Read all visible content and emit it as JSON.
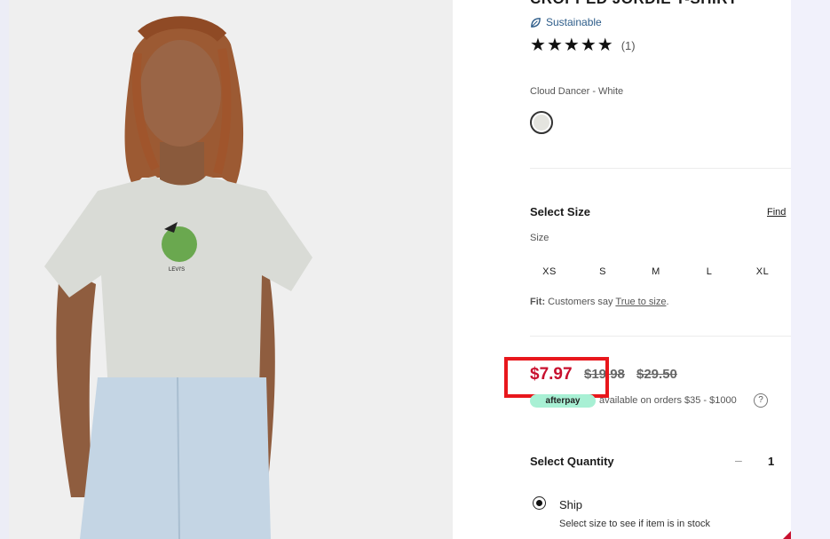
{
  "product": {
    "title": "Cropped Jordie T-Shirt",
    "sustainable_label": "Sustainable",
    "rating_stars": 5,
    "review_count": "(1)",
    "color_name": "Cloud Dancer - White"
  },
  "size_section": {
    "heading": "Select Size",
    "find_link": "Find",
    "size_label": "Size",
    "sizes": [
      "XS",
      "S",
      "M",
      "L",
      "XL"
    ],
    "fit_prefix": "Fit:",
    "fit_text": " Customers say ",
    "fit_link": "True to size",
    "fit_end": "."
  },
  "pricing": {
    "sale_price": "$7.97",
    "was_price_1": "$19.98",
    "was_price_2": "$29.50",
    "afterpay_label": "afterpay",
    "afterpay_text": "available on orders $35 - $1000",
    "help_glyph": "?"
  },
  "quantity": {
    "heading": "Select Quantity",
    "minus_glyph": "–",
    "value": "1"
  },
  "shipping": {
    "option_label": "Ship",
    "option_note": "Select size to see if item is in stock"
  },
  "colors": {
    "sale_red": "#c8102e",
    "highlight_box": "#e8171c",
    "link_blue": "#2e5d8a"
  }
}
